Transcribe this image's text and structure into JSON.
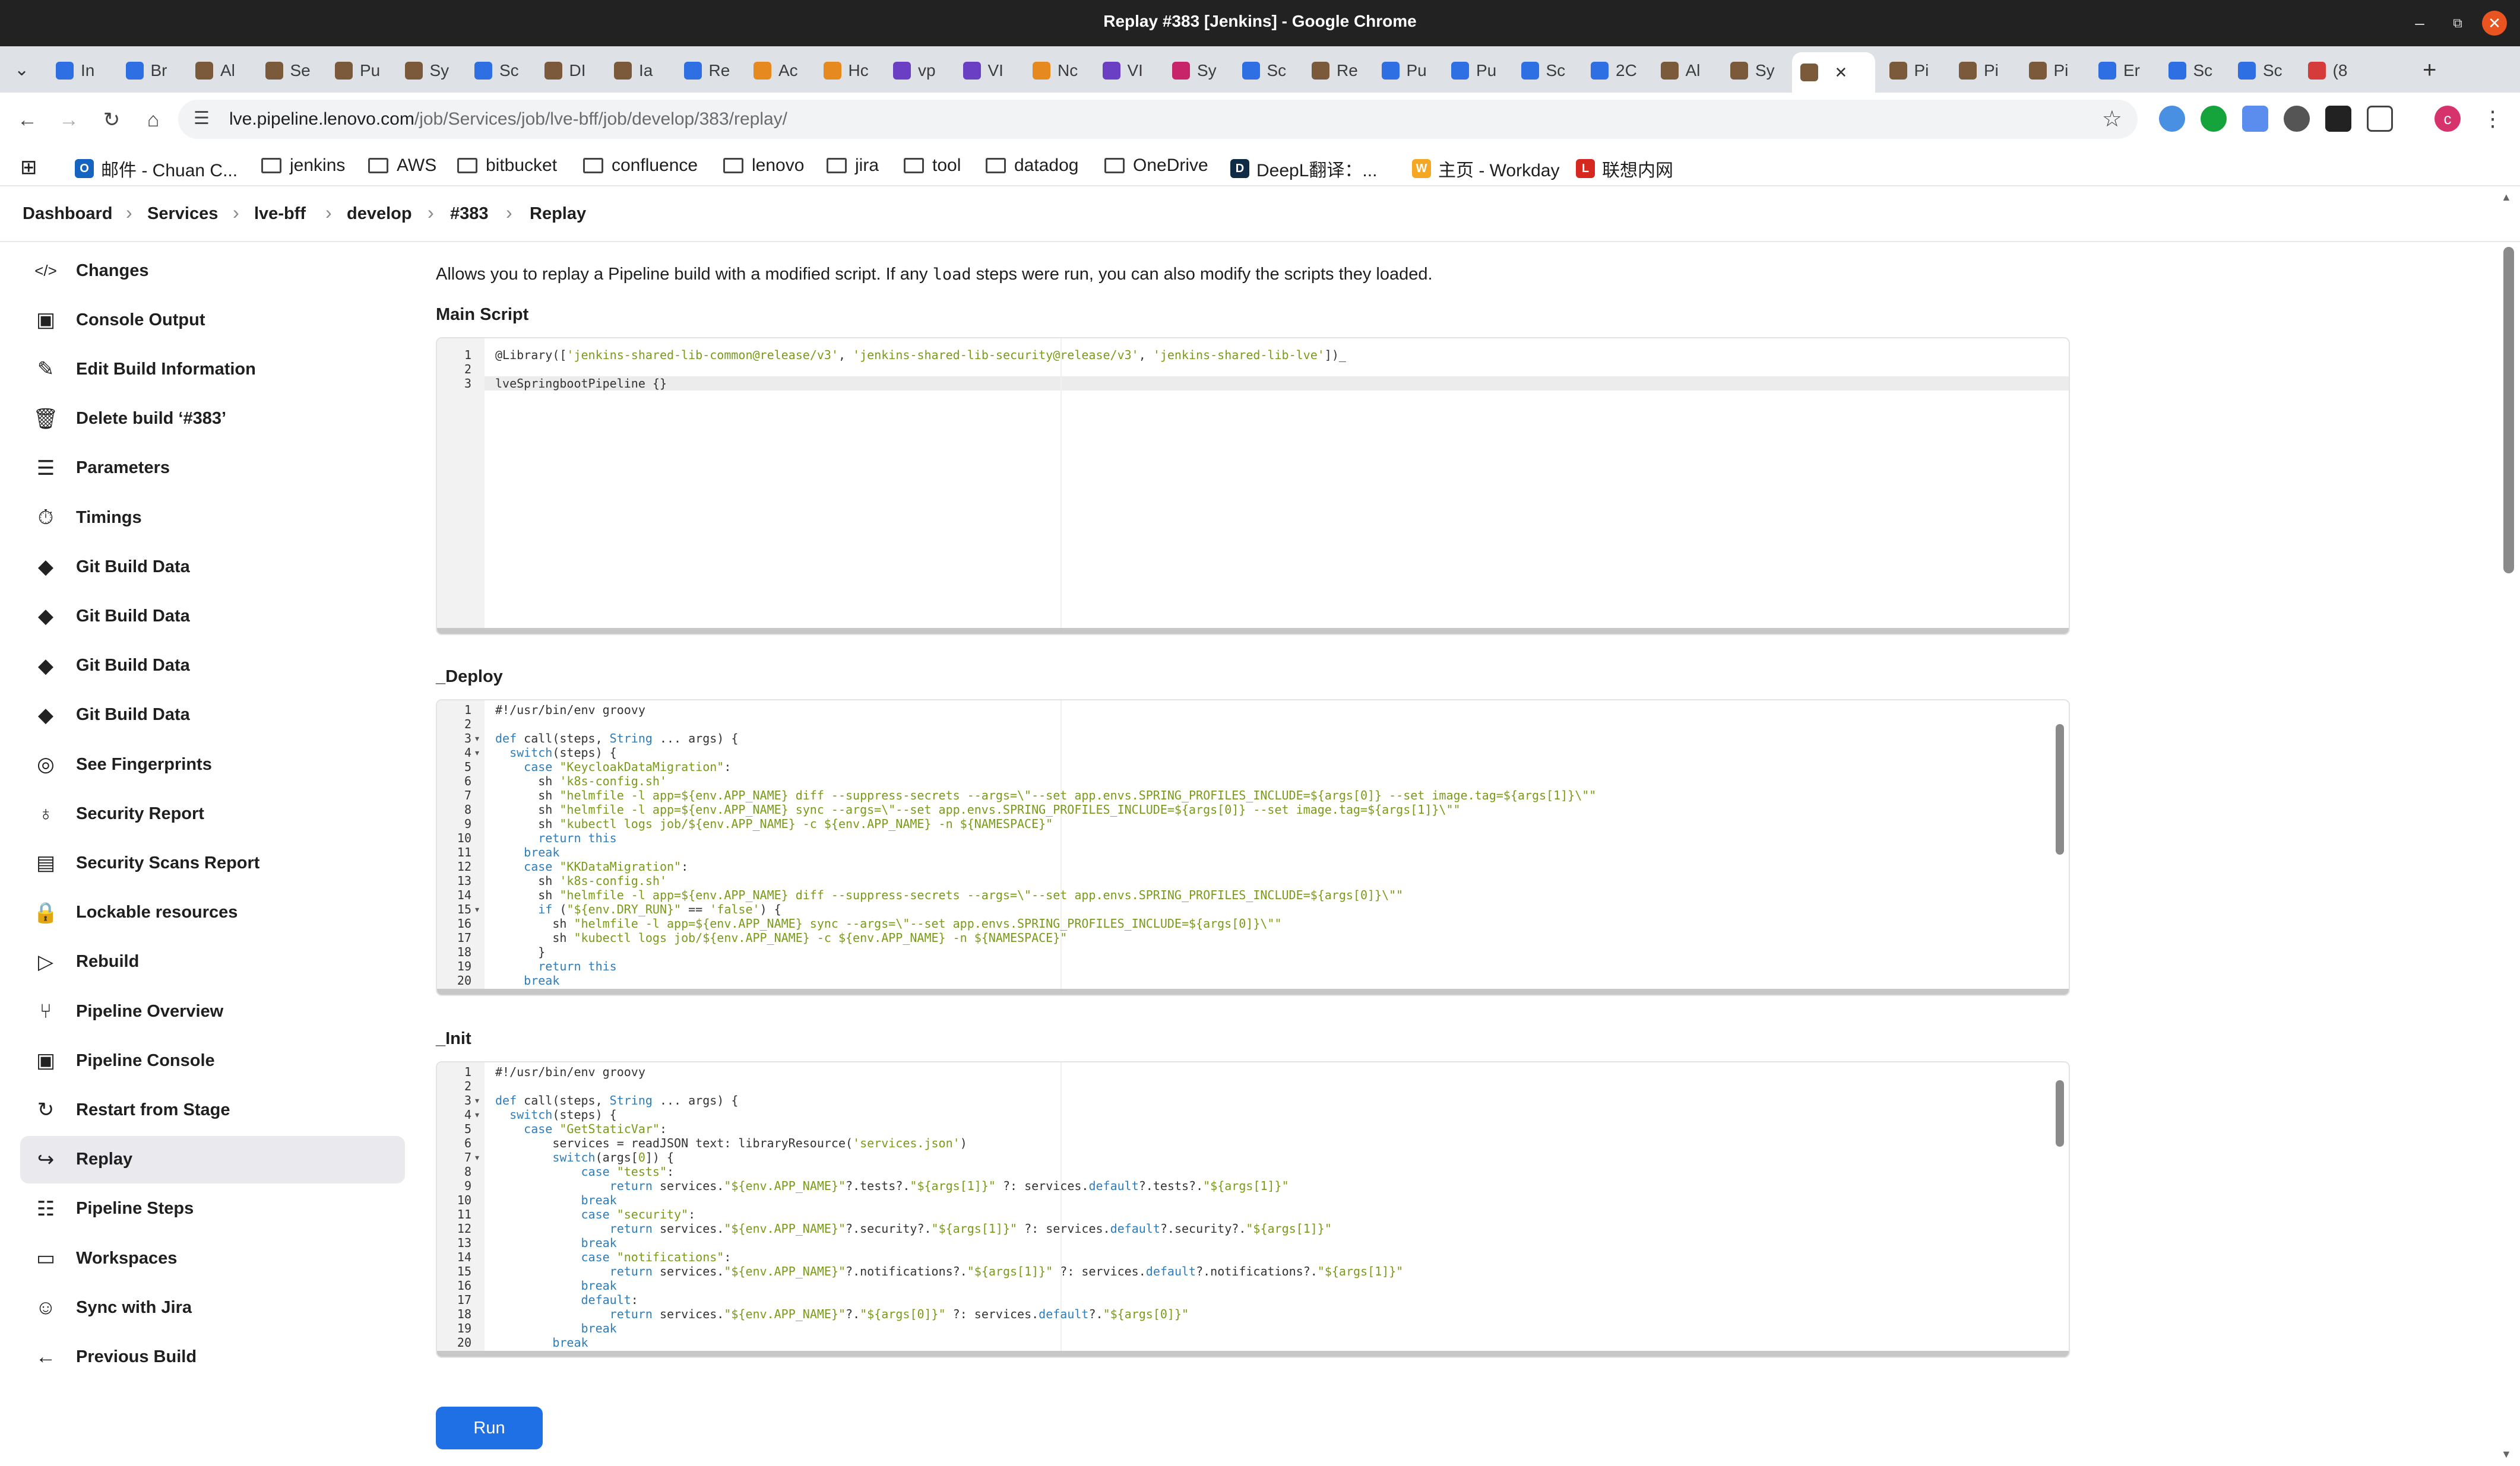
{
  "window": {
    "title": "Replay #383 [Jenkins] - Google Chrome",
    "minimize_icon": "–",
    "maximize_icon": "⧉",
    "close_icon": "✕"
  },
  "tabs": [
    {
      "label": "In",
      "color": "#2f6fe4"
    },
    {
      "label": "Br",
      "color": "#2f6fe4"
    },
    {
      "label": "Al",
      "color": "#7a5a3a"
    },
    {
      "label": "Se",
      "color": "#7a5a3a"
    },
    {
      "label": "Pu",
      "color": "#7a5a3a"
    },
    {
      "label": "Sy",
      "color": "#7a5a3a"
    },
    {
      "label": "Sc",
      "color": "#2f6fe4"
    },
    {
      "label": "DI",
      "color": "#7a5a3a"
    },
    {
      "label": "Ia",
      "color": "#7a5a3a"
    },
    {
      "label": "Re",
      "color": "#2f6fe4"
    },
    {
      "label": "Ac",
      "color": "#e68a1f"
    },
    {
      "label": "Hc",
      "color": "#e68a1f"
    },
    {
      "label": "vp",
      "color": "#6a3fc4"
    },
    {
      "label": "VI",
      "color": "#6a3fc4"
    },
    {
      "label": "Nc",
      "color": "#e68a1f"
    },
    {
      "label": "VI",
      "color": "#6a3fc4"
    },
    {
      "label": "Sy",
      "color": "#c8246a"
    },
    {
      "label": "Sc",
      "color": "#2f6fe4"
    },
    {
      "label": "Re",
      "color": "#7a5a3a"
    },
    {
      "label": "Pu",
      "color": "#2f6fe4"
    },
    {
      "label": "Pu",
      "color": "#2f6fe4"
    },
    {
      "label": "Sc",
      "color": "#2f6fe4"
    },
    {
      "label": "2C",
      "color": "#2f6fe4"
    },
    {
      "label": "Al",
      "color": "#7a5a3a"
    },
    {
      "label": "Sy",
      "color": "#7a5a3a"
    },
    {
      "label": "",
      "color": "#7a5a3a",
      "active": true
    },
    {
      "label": "Pi",
      "color": "#7a5a3a"
    },
    {
      "label": "Pi",
      "color": "#7a5a3a"
    },
    {
      "label": "Pi",
      "color": "#7a5a3a"
    },
    {
      "label": "Er",
      "color": "#2f6fe4"
    },
    {
      "label": "Sc",
      "color": "#2f6fe4"
    },
    {
      "label": "Sc",
      "color": "#2f6fe4"
    },
    {
      "label": "(8",
      "color": "#d63b3b"
    }
  ],
  "tab_close_icon": "✕",
  "new_tab_icon": "+",
  "tab_dropdown_icon": "⌄",
  "toolbar": {
    "back_icon": "←",
    "forward_icon": "→",
    "reload_icon": "↻",
    "home_icon": "⌂",
    "site_info_icon": "☰",
    "url_host": "lve.pipeline.lenovo.com",
    "url_path": "/job/Services/job/lve-bff/job/develop/383/replay/",
    "bookmark_star_icon": "☆",
    "menu_icon": "⋮",
    "profile_initial": "c"
  },
  "bookmarks": [
    {
      "label": "邮件 - Chuan C...",
      "type": "app",
      "color": "#1565c0",
      "glyph": "O"
    },
    {
      "label": "jenkins",
      "type": "folder"
    },
    {
      "label": "AWS",
      "type": "folder"
    },
    {
      "label": "bitbucket",
      "type": "folder"
    },
    {
      "label": "confluence",
      "type": "folder"
    },
    {
      "label": "lenovo",
      "type": "folder"
    },
    {
      "label": "jira",
      "type": "folder"
    },
    {
      "label": "tool",
      "type": "folder"
    },
    {
      "label": "datadog",
      "type": "folder"
    },
    {
      "label": "OneDrive",
      "type": "folder"
    },
    {
      "label": "DeepL翻译：...",
      "type": "app",
      "color": "#0f2b46",
      "glyph": "D"
    },
    {
      "label": "主页 - Workday",
      "type": "app",
      "color": "#f5a623",
      "glyph": "W"
    },
    {
      "label": "联想内网",
      "type": "app",
      "color": "#d6281e",
      "glyph": "L"
    }
  ],
  "apps_icon": "⊞",
  "breadcrumb": [
    "Dashboard",
    "Services",
    "lve-bff",
    "develop",
    "#383",
    "Replay"
  ],
  "breadcrumb_sep": "›",
  "sidebar": [
    {
      "label": "Changes",
      "icon": "code-icon",
      "glyph": "</>"
    },
    {
      "label": "Console Output",
      "icon": "terminal-icon",
      "glyph": "▣"
    },
    {
      "label": "Edit Build Information",
      "icon": "edit-icon",
      "glyph": "✎"
    },
    {
      "label": "Delete build ‘#383’",
      "icon": "trash-icon",
      "glyph": "🗑"
    },
    {
      "label": "Parameters",
      "icon": "sliders-icon",
      "glyph": "☰"
    },
    {
      "label": "Timings",
      "icon": "stopwatch-icon",
      "glyph": "⏱"
    },
    {
      "label": "Git Build Data",
      "icon": "git-icon",
      "glyph": "◆"
    },
    {
      "label": "Git Build Data",
      "icon": "git-icon",
      "glyph": "◆"
    },
    {
      "label": "Git Build Data",
      "icon": "git-icon",
      "glyph": "◆"
    },
    {
      "label": "Git Build Data",
      "icon": "git-icon",
      "glyph": "◆"
    },
    {
      "label": "See Fingerprints",
      "icon": "fingerprint-icon",
      "glyph": "◎"
    },
    {
      "label": "Security Report",
      "icon": "security-icon",
      "glyph": "♁"
    },
    {
      "label": "Security Scans Report",
      "icon": "document-icon",
      "glyph": "▤"
    },
    {
      "label": "Lockable resources",
      "icon": "lock-icon",
      "glyph": "🔒"
    },
    {
      "label": "Rebuild",
      "icon": "play-icon",
      "glyph": "▷"
    },
    {
      "label": "Pipeline Overview",
      "icon": "branch-icon",
      "glyph": "⑂"
    },
    {
      "label": "Pipeline Console",
      "icon": "terminal-icon",
      "glyph": "▣"
    },
    {
      "label": "Restart from Stage",
      "icon": "restart-icon",
      "glyph": "↻"
    },
    {
      "label": "Replay",
      "icon": "replay-icon",
      "glyph": "↪",
      "active": true
    },
    {
      "label": "Pipeline Steps",
      "icon": "list-icon",
      "glyph": "☷"
    },
    {
      "label": "Workspaces",
      "icon": "folder-icon",
      "glyph": "▭"
    },
    {
      "label": "Sync with Jira",
      "icon": "jira-avatar-icon",
      "glyph": "☺"
    },
    {
      "label": "Previous Build",
      "icon": "arrow-left-icon",
      "glyph": "←"
    }
  ],
  "main": {
    "intro_pre": "Allows you to replay a Pipeline build with a modified script. If any ",
    "intro_code": "load",
    "intro_post": " steps were run, you can also modify the scripts they loaded.",
    "main_script_label": "Main Script",
    "deploy_label": "_Deploy",
    "init_label": "_Init",
    "run_label": "Run"
  },
  "main_script": [
    {
      "n": "1",
      "html": "@Library([<span class='s'>'jenkins-shared-lib-common@release/v3'</span>, <span class='s'>'jenkins-shared-lib-security@release/v3'</span>, <span class='s'>'jenkins-shared-lib-lve'</span>])_"
    },
    {
      "n": "2",
      "html": ""
    },
    {
      "n": "3",
      "html": "lveSpringbootPipeline {}"
    }
  ],
  "deploy_script": [
    {
      "n": "1",
      "html": "#!/usr/bin/env groovy"
    },
    {
      "n": "2",
      "html": ""
    },
    {
      "n": "3",
      "fold": true,
      "html": "<span class='k'>def</span> call(steps, <span class='k'>String</span> ... args) {"
    },
    {
      "n": "4",
      "fold": true,
      "html": "  <span class='k'>switch</span>(steps) {"
    },
    {
      "n": "5",
      "html": "    <span class='k'>case</span> <span class='s'>\"KeycloakDataMigration\"</span>:"
    },
    {
      "n": "6",
      "html": "      sh <span class='s'>'k8s-config.sh'</span>"
    },
    {
      "n": "7",
      "html": "      sh <span class='s'>\"helmfile -l app=${env.APP_NAME} diff --suppress-secrets --args=\\\"--set app.envs.SPRING_PROFILES_INCLUDE=${args[0]} --set image.tag=${args[1]}\\\"\"</span>"
    },
    {
      "n": "8",
      "html": "      sh <span class='s'>\"helmfile -l app=${env.APP_NAME} sync --args=\\\"--set app.envs.SPRING_PROFILES_INCLUDE=${args[0]} --set image.tag=${args[1]}\\\"\"</span>"
    },
    {
      "n": "9",
      "html": "      sh <span class='s'>\"kubectl logs job/${env.APP_NAME} -c ${env.APP_NAME} -n ${NAMESPACE}\"</span>"
    },
    {
      "n": "10",
      "html": "      <span class='k'>return this</span>"
    },
    {
      "n": "11",
      "html": "    <span class='k'>break</span>"
    },
    {
      "n": "12",
      "html": "    <span class='k'>case</span> <span class='s'>\"KKDataMigration\"</span>:"
    },
    {
      "n": "13",
      "html": "      sh <span class='s'>'k8s-config.sh'</span>"
    },
    {
      "n": "14",
      "html": "      sh <span class='s'>\"helmfile -l app=${env.APP_NAME} diff --suppress-secrets --args=\\\"--set app.envs.SPRING_PROFILES_INCLUDE=${args[0]}\\\"\"</span>"
    },
    {
      "n": "15",
      "fold": true,
      "html": "      <span class='k'>if</span> (<span class='s'>\"${env.DRY_RUN}\"</span> == <span class='s'>'false'</span>) {"
    },
    {
      "n": "16",
      "html": "        sh <span class='s'>\"helmfile -l app=${env.APP_NAME} sync --args=\\\"--set app.envs.SPRING_PROFILES_INCLUDE=${args[0]}\\\"\"</span>"
    },
    {
      "n": "17",
      "html": "        sh <span class='s'>\"kubectl logs job/${env.APP_NAME} -c ${env.APP_NAME} -n ${NAMESPACE}\"</span>"
    },
    {
      "n": "18",
      "html": "      }"
    },
    {
      "n": "19",
      "html": "      <span class='k'>return this</span>"
    },
    {
      "n": "20",
      "html": "    <span class='k'>break</span>"
    }
  ],
  "init_script": [
    {
      "n": "1",
      "html": "#!/usr/bin/env groovy"
    },
    {
      "n": "2",
      "html": ""
    },
    {
      "n": "3",
      "fold": true,
      "html": "<span class='k'>def</span> call(steps, <span class='k'>String</span> ... args) {"
    },
    {
      "n": "4",
      "fold": true,
      "html": "  <span class='k'>switch</span>(steps) {"
    },
    {
      "n": "5",
      "html": "    <span class='k'>case</span> <span class='s'>\"GetStaticVar\"</span>:"
    },
    {
      "n": "6",
      "html": "        services = readJSON text: libraryResource(<span class='s'>'services.json'</span>)"
    },
    {
      "n": "7",
      "fold": true,
      "html": "        <span class='k'>switch</span>(args[<span class='s'>0</span>]) {"
    },
    {
      "n": "8",
      "html": "            <span class='k'>case</span> <span class='s'>\"tests\"</span>:"
    },
    {
      "n": "9",
      "html": "                <span class='k'>return</span> services.<span class='s'>\"${env.APP_NAME}\"</span>?.tests?.<span class='s'>\"${args[1]}\"</span> ?: services.<span class='k'>default</span>?.tests?.<span class='s'>\"${args[1]}\"</span>"
    },
    {
      "n": "10",
      "html": "            <span class='k'>break</span>"
    },
    {
      "n": "11",
      "html": "            <span class='k'>case</span> <span class='s'>\"security\"</span>:"
    },
    {
      "n": "12",
      "html": "                <span class='k'>return</span> services.<span class='s'>\"${env.APP_NAME}\"</span>?.security?.<span class='s'>\"${args[1]}\"</span> ?: services.<span class='k'>default</span>?.security?.<span class='s'>\"${args[1]}\"</span>"
    },
    {
      "n": "13",
      "html": "            <span class='k'>break</span>"
    },
    {
      "n": "14",
      "html": "            <span class='k'>case</span> <span class='s'>\"notifications\"</span>:"
    },
    {
      "n": "15",
      "html": "                <span class='k'>return</span> services.<span class='s'>\"${env.APP_NAME}\"</span>?.notifications?.<span class='s'>\"${args[1]}\"</span> ?: services.<span class='k'>default</span>?.notifications?.<span class='s'>\"${args[1]}\"</span>"
    },
    {
      "n": "16",
      "html": "            <span class='k'>break</span>"
    },
    {
      "n": "17",
      "html": "            <span class='k'>default</span>:"
    },
    {
      "n": "18",
      "html": "                <span class='k'>return</span> services.<span class='s'>\"${env.APP_NAME}\"</span>?.<span class='s'>\"${args[0]}\"</span> ?: services.<span class='k'>default</span>?.<span class='s'>\"${args[0]}\"</span>"
    },
    {
      "n": "19",
      "html": "            <span class='k'>break</span>"
    },
    {
      "n": "20",
      "html": "        <span class='k'>break</span>"
    }
  ]
}
